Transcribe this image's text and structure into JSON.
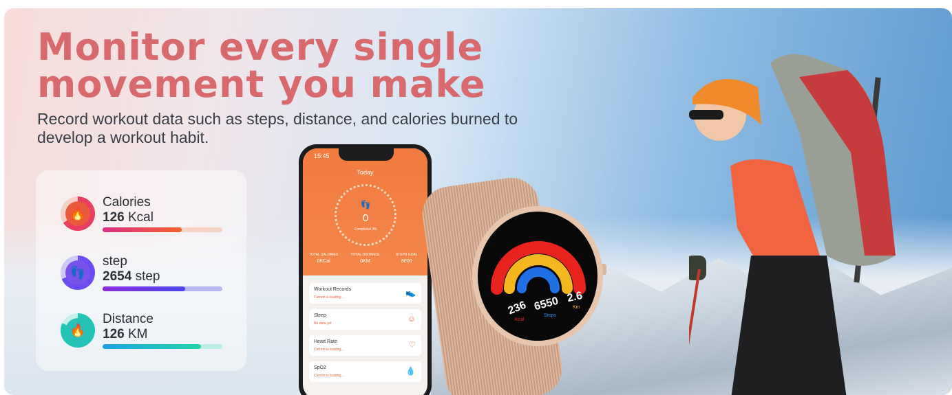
{
  "headline": {
    "line1": "Monitor every single",
    "line2": "movement you make"
  },
  "subtitle": "Record workout data such as steps, distance, and calories burned to develop a workout habit.",
  "stats": [
    {
      "label": "Calories",
      "value": "126",
      "unit": "Kcal",
      "icon": "flame-icon",
      "color": "#e83e62",
      "progress": 0.66
    },
    {
      "label": "step",
      "value": "2654",
      "unit": "step",
      "icon": "footprints-icon",
      "color": "#6b4cf1",
      "progress": 0.69
    },
    {
      "label": "Distance",
      "value": "126",
      "unit": "KM",
      "icon": "flame-icon",
      "color": "#23c4b8",
      "progress": 0.82
    }
  ],
  "phone": {
    "time": "15:45",
    "title": "Today",
    "steps": "0",
    "completed": "Completed  0%",
    "totals": [
      {
        "head": "TOTAL CALORIES",
        "val": "0KCal"
      },
      {
        "head": "TOTAL DISTANCE",
        "val": "0KM"
      },
      {
        "head": "STEPS GOAL",
        "val": "8000"
      }
    ],
    "items": [
      {
        "name": "Workout Records",
        "status": "Current is loading..."
      },
      {
        "name": "Sleep",
        "status": "No data yet"
      },
      {
        "name": "Heart Rate",
        "status": "Current is loading..."
      },
      {
        "name": "SpO2",
        "status": "Current is loading..."
      }
    ]
  },
  "watch": {
    "cal": "236",
    "cal_unit": "Kcal",
    "steps": "6550",
    "steps_unit": "Steps",
    "dist": "2.6",
    "dist_unit": "Km"
  }
}
